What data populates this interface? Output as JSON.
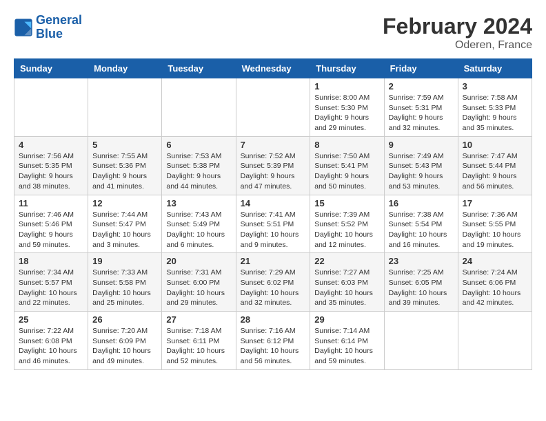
{
  "header": {
    "logo_line1": "General",
    "logo_line2": "Blue",
    "month_year": "February 2024",
    "location": "Oderen, France"
  },
  "weekdays": [
    "Sunday",
    "Monday",
    "Tuesday",
    "Wednesday",
    "Thursday",
    "Friday",
    "Saturday"
  ],
  "weeks": [
    [
      {
        "day": "",
        "info": ""
      },
      {
        "day": "",
        "info": ""
      },
      {
        "day": "",
        "info": ""
      },
      {
        "day": "",
        "info": ""
      },
      {
        "day": "1",
        "info": "Sunrise: 8:00 AM\nSunset: 5:30 PM\nDaylight: 9 hours\nand 29 minutes."
      },
      {
        "day": "2",
        "info": "Sunrise: 7:59 AM\nSunset: 5:31 PM\nDaylight: 9 hours\nand 32 minutes."
      },
      {
        "day": "3",
        "info": "Sunrise: 7:58 AM\nSunset: 5:33 PM\nDaylight: 9 hours\nand 35 minutes."
      }
    ],
    [
      {
        "day": "4",
        "info": "Sunrise: 7:56 AM\nSunset: 5:35 PM\nDaylight: 9 hours\nand 38 minutes."
      },
      {
        "day": "5",
        "info": "Sunrise: 7:55 AM\nSunset: 5:36 PM\nDaylight: 9 hours\nand 41 minutes."
      },
      {
        "day": "6",
        "info": "Sunrise: 7:53 AM\nSunset: 5:38 PM\nDaylight: 9 hours\nand 44 minutes."
      },
      {
        "day": "7",
        "info": "Sunrise: 7:52 AM\nSunset: 5:39 PM\nDaylight: 9 hours\nand 47 minutes."
      },
      {
        "day": "8",
        "info": "Sunrise: 7:50 AM\nSunset: 5:41 PM\nDaylight: 9 hours\nand 50 minutes."
      },
      {
        "day": "9",
        "info": "Sunrise: 7:49 AM\nSunset: 5:43 PM\nDaylight: 9 hours\nand 53 minutes."
      },
      {
        "day": "10",
        "info": "Sunrise: 7:47 AM\nSunset: 5:44 PM\nDaylight: 9 hours\nand 56 minutes."
      }
    ],
    [
      {
        "day": "11",
        "info": "Sunrise: 7:46 AM\nSunset: 5:46 PM\nDaylight: 9 hours\nand 59 minutes."
      },
      {
        "day": "12",
        "info": "Sunrise: 7:44 AM\nSunset: 5:47 PM\nDaylight: 10 hours\nand 3 minutes."
      },
      {
        "day": "13",
        "info": "Sunrise: 7:43 AM\nSunset: 5:49 PM\nDaylight: 10 hours\nand 6 minutes."
      },
      {
        "day": "14",
        "info": "Sunrise: 7:41 AM\nSunset: 5:51 PM\nDaylight: 10 hours\nand 9 minutes."
      },
      {
        "day": "15",
        "info": "Sunrise: 7:39 AM\nSunset: 5:52 PM\nDaylight: 10 hours\nand 12 minutes."
      },
      {
        "day": "16",
        "info": "Sunrise: 7:38 AM\nSunset: 5:54 PM\nDaylight: 10 hours\nand 16 minutes."
      },
      {
        "day": "17",
        "info": "Sunrise: 7:36 AM\nSunset: 5:55 PM\nDaylight: 10 hours\nand 19 minutes."
      }
    ],
    [
      {
        "day": "18",
        "info": "Sunrise: 7:34 AM\nSunset: 5:57 PM\nDaylight: 10 hours\nand 22 minutes."
      },
      {
        "day": "19",
        "info": "Sunrise: 7:33 AM\nSunset: 5:58 PM\nDaylight: 10 hours\nand 25 minutes."
      },
      {
        "day": "20",
        "info": "Sunrise: 7:31 AM\nSunset: 6:00 PM\nDaylight: 10 hours\nand 29 minutes."
      },
      {
        "day": "21",
        "info": "Sunrise: 7:29 AM\nSunset: 6:02 PM\nDaylight: 10 hours\nand 32 minutes."
      },
      {
        "day": "22",
        "info": "Sunrise: 7:27 AM\nSunset: 6:03 PM\nDaylight: 10 hours\nand 35 minutes."
      },
      {
        "day": "23",
        "info": "Sunrise: 7:25 AM\nSunset: 6:05 PM\nDaylight: 10 hours\nand 39 minutes."
      },
      {
        "day": "24",
        "info": "Sunrise: 7:24 AM\nSunset: 6:06 PM\nDaylight: 10 hours\nand 42 minutes."
      }
    ],
    [
      {
        "day": "25",
        "info": "Sunrise: 7:22 AM\nSunset: 6:08 PM\nDaylight: 10 hours\nand 46 minutes."
      },
      {
        "day": "26",
        "info": "Sunrise: 7:20 AM\nSunset: 6:09 PM\nDaylight: 10 hours\nand 49 minutes."
      },
      {
        "day": "27",
        "info": "Sunrise: 7:18 AM\nSunset: 6:11 PM\nDaylight: 10 hours\nand 52 minutes."
      },
      {
        "day": "28",
        "info": "Sunrise: 7:16 AM\nSunset: 6:12 PM\nDaylight: 10 hours\nand 56 minutes."
      },
      {
        "day": "29",
        "info": "Sunrise: 7:14 AM\nSunset: 6:14 PM\nDaylight: 10 hours\nand 59 minutes."
      },
      {
        "day": "",
        "info": ""
      },
      {
        "day": "",
        "info": ""
      }
    ]
  ]
}
